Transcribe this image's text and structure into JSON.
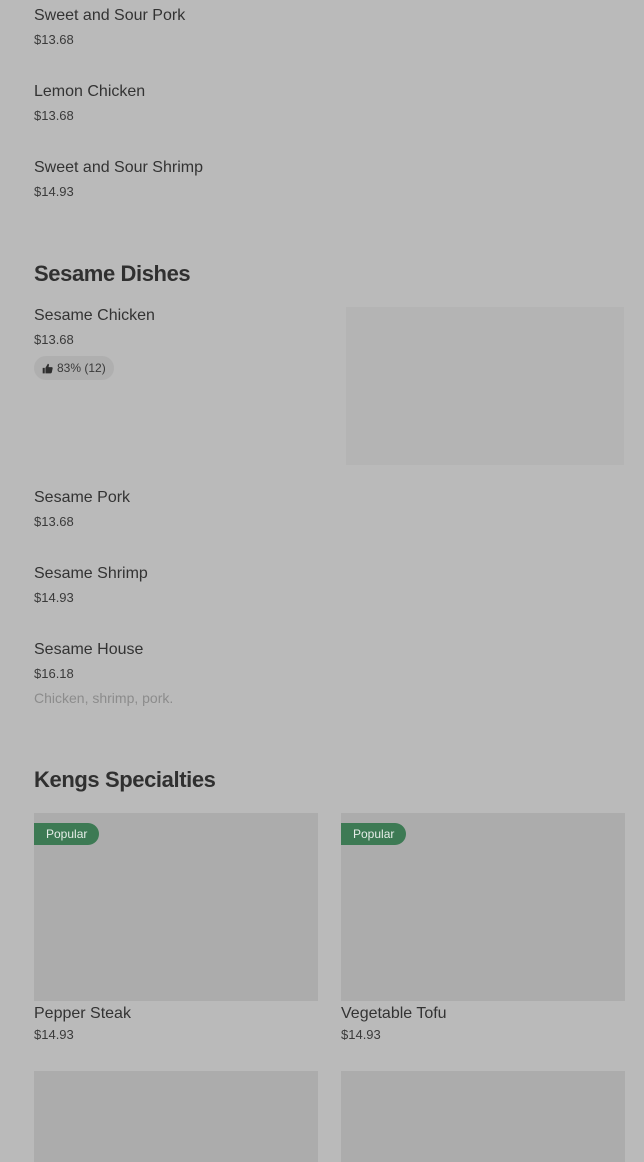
{
  "menu_items_top": [
    {
      "name": "Sweet and Sour Pork",
      "price": "$13.68"
    },
    {
      "name": "Lemon Chicken",
      "price": "$13.68"
    },
    {
      "name": "Sweet and Sour Shrimp",
      "price": "$14.93"
    }
  ],
  "sesame_section": {
    "title": "Sesame Dishes",
    "items": [
      {
        "name": "Sesame Chicken",
        "price": "$13.68",
        "rating": "83% (12)"
      },
      {
        "name": "Sesame Pork",
        "price": "$13.68"
      },
      {
        "name": "Sesame Shrimp",
        "price": "$14.93"
      },
      {
        "name": "Sesame House",
        "price": "$16.18",
        "description": "Chicken, shrimp, pork."
      }
    ]
  },
  "specialties_section": {
    "title": "Kengs Specialties",
    "cards": [
      {
        "badge": "Popular",
        "name": "Pepper Steak",
        "price": "$14.93"
      },
      {
        "badge": "Popular",
        "name": "Vegetable Tofu",
        "price": "$14.93"
      }
    ]
  },
  "colors": {
    "background": "#bababa",
    "popular_badge": "#3d7a54",
    "text": "#333333",
    "muted_text": "#8c8c8c"
  },
  "icons": {
    "rating": "thumbs-up-icon"
  }
}
